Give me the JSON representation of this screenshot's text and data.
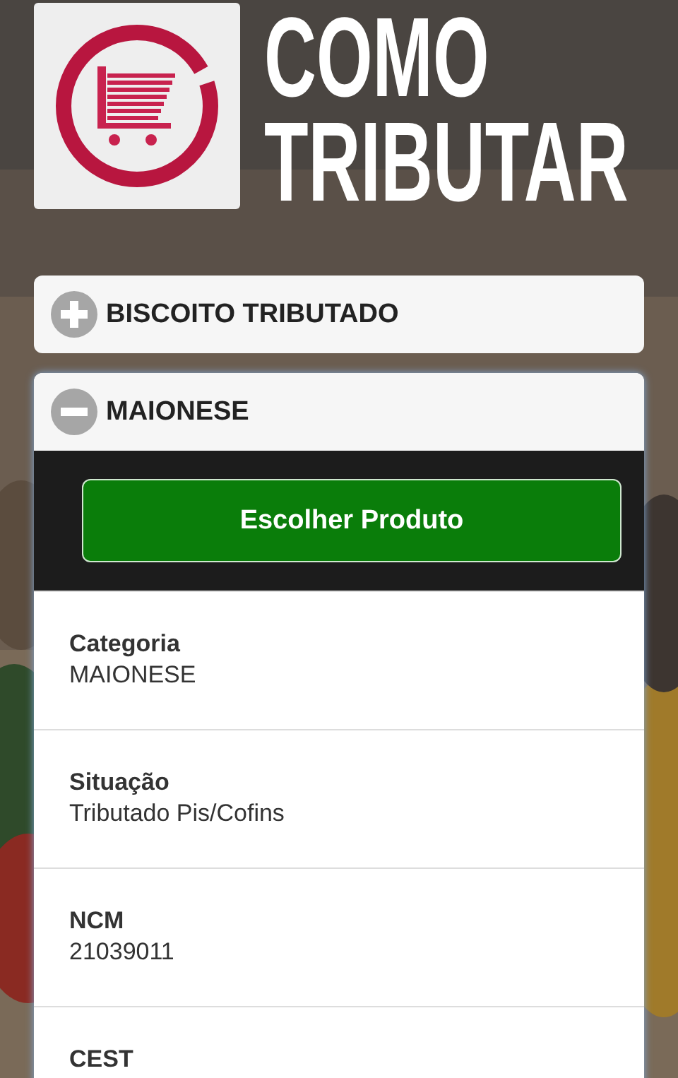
{
  "header": {
    "title_lines": [
      "COMO",
      "TRIBUTAR"
    ]
  },
  "accordion": [
    {
      "title": "BISCOITO TRIBUTADO",
      "expanded": false
    },
    {
      "title": "MAIONESE",
      "expanded": true,
      "action": "Escolher Produto",
      "fields": [
        {
          "label": "Categoria",
          "value": "MAIONESE"
        },
        {
          "label": "Situação",
          "value": "Tributado Pis/Cofins"
        },
        {
          "label": "NCM",
          "value": "21039011"
        },
        {
          "label": "CEST"
        }
      ]
    }
  ]
}
